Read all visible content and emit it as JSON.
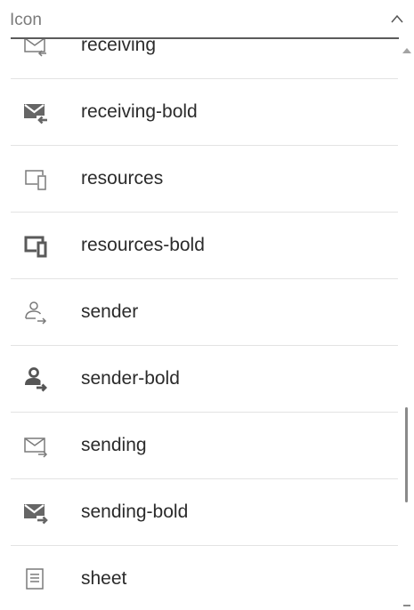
{
  "header": {
    "label": "Icon",
    "chevron_icon": "chevron-up-icon"
  },
  "items": [
    {
      "label": "receiving",
      "icon": "receiving-icon"
    },
    {
      "label": "receiving-bold",
      "icon": "receiving-bold-icon"
    },
    {
      "label": "resources",
      "icon": "resources-icon"
    },
    {
      "label": "resources-bold",
      "icon": "resources-bold-icon"
    },
    {
      "label": "sender",
      "icon": "sender-icon"
    },
    {
      "label": "sender-bold",
      "icon": "sender-bold-icon"
    },
    {
      "label": "sending",
      "icon": "sending-icon"
    },
    {
      "label": "sending-bold",
      "icon": "sending-bold-icon"
    },
    {
      "label": "sheet",
      "icon": "sheet-icon"
    }
  ],
  "colors": {
    "icon": "#5f5f5f",
    "text": "#2b2b2b",
    "divider": "#e3e3e3"
  }
}
